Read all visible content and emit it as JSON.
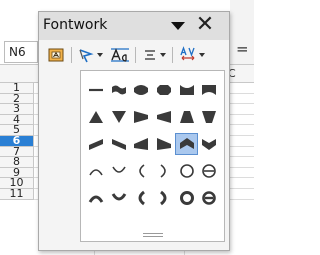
{
  "spreadsheet": {
    "name_box_value": "N6",
    "formula_equals": "=",
    "partial_column_letter": "C",
    "rows": [
      "1",
      "2",
      "3",
      "4",
      "5",
      "6",
      "7",
      "8",
      "9",
      "10",
      "11"
    ],
    "active_row": "6"
  },
  "fontwork_toolbar": {
    "title": "Fontwork",
    "buttons": [
      {
        "name": "fontwork-gallery-button",
        "icon": "fontwork-gallery-icon"
      },
      {
        "name": "fontwork-shape-button",
        "icon": "fontwork-shape-icon",
        "has_dropdown": true
      },
      {
        "name": "fontwork-same-letter-heights-button",
        "icon": "same-letter-heights-icon"
      },
      {
        "name": "fontwork-alignment-button",
        "icon": "align-center-icon",
        "has_dropdown": true
      },
      {
        "name": "fontwork-character-spacing-button",
        "icon": "character-spacing-icon",
        "has_dropdown": true
      }
    ]
  },
  "shape_palette": {
    "colors": {
      "shape_fill": "#3a3a3a",
      "selected_bg": "#aac8ee",
      "selected_border": "#5b8fd0"
    },
    "rows": [
      [
        "plain-text-icon",
        "wave-icon",
        "inflate-icon",
        "stop-icon",
        "curve-down-icon",
        "curve-up-icon"
      ],
      [
        "triangle-up-icon",
        "triangle-down-icon",
        "fade-right-icon",
        "fade-left-icon",
        "fade-up-icon",
        "fade-down-icon"
      ],
      [
        "slant-up-icon",
        "slant-down-icon",
        "fade-up-right-icon",
        "fade-up-left-icon",
        "chevron-up-icon",
        "chevron-down-icon"
      ],
      [
        "arch-up-curve-icon",
        "arch-down-curve-icon",
        "arch-left-curve-icon",
        "arch-right-curve-icon",
        "circle-curve-icon",
        "open-circle-curve-icon"
      ],
      [
        "arch-up-pour-icon",
        "arch-down-pour-icon",
        "arch-left-pour-icon",
        "arch-right-pour-icon",
        "circle-pour-icon",
        "open-circle-pour-icon"
      ]
    ],
    "selected": "chevron-up-icon"
  }
}
